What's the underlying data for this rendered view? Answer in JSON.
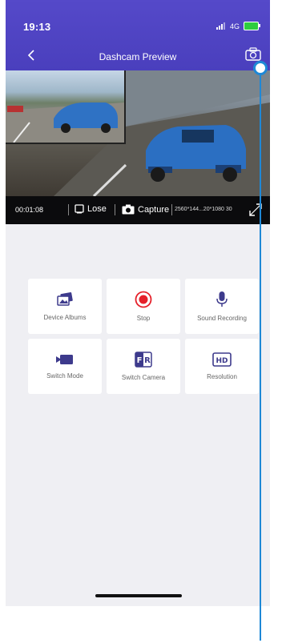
{
  "status_bar": {
    "time": "19:13",
    "network": "4G"
  },
  "header": {
    "title": "Dashcam Preview"
  },
  "video_bar": {
    "timer": "00:01:08",
    "lose_label": "Lose",
    "capture_label": "Capture",
    "resolution_text": "2560*144...20*1080 30"
  },
  "actions": [
    {
      "label": "Device Albums",
      "icon": "device-albums-icon"
    },
    {
      "label": "Stop",
      "icon": "stop-record-icon"
    },
    {
      "label": "Sound Recording",
      "icon": "microphone-icon"
    },
    {
      "label": "Switch Mode",
      "icon": "video-camera-icon"
    },
    {
      "label": "Switch Camera",
      "icon": "front-rear-switch-icon"
    },
    {
      "label": "Resolution",
      "icon": "hd-icon"
    }
  ],
  "colors": {
    "header": "#4a3fbd",
    "accent_red": "#e5202a",
    "icon_purple": "#3d3a8c",
    "callout": "#1e88d6"
  }
}
